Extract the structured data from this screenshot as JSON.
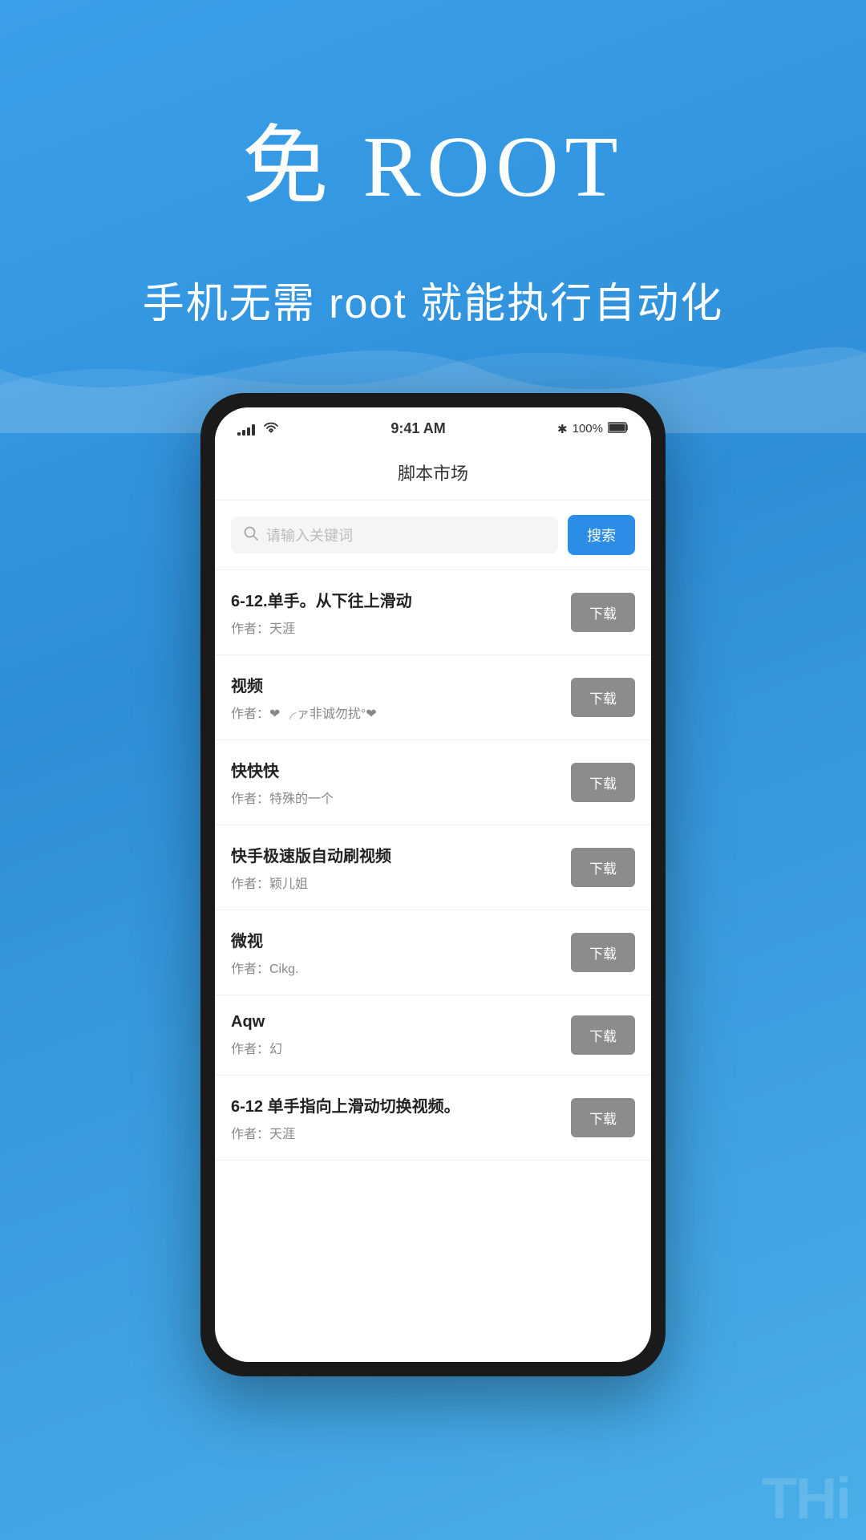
{
  "hero": {
    "title": "免 ROOT",
    "subtitle": "手机无需 root 就能执行自动化"
  },
  "phone": {
    "statusBar": {
      "time": "9:41 AM",
      "battery": "100%",
      "bluetooth": "✱"
    },
    "appTitle": "脚本市场",
    "search": {
      "placeholder": "请输入关键词",
      "buttonLabel": "搜索"
    },
    "scripts": [
      {
        "name": "6-12.单手。从下往上滑动",
        "author": "作者：天涯",
        "authorHasHeart": false,
        "downloadLabel": "下载"
      },
      {
        "name": "视频",
        "author": "作者：❤ ╭ァ非诚勿扰°❤",
        "authorHasHeart": true,
        "downloadLabel": "下载"
      },
      {
        "name": "快快快",
        "author": "作者：特殊的一个",
        "authorHasHeart": false,
        "downloadLabel": "下载"
      },
      {
        "name": "快手极速版自动刷视频",
        "author": "作者：颖儿姐",
        "authorHasHeart": false,
        "downloadLabel": "下载"
      },
      {
        "name": "微视",
        "author": "作者：Cikg.",
        "authorHasHeart": false,
        "downloadLabel": "下载"
      },
      {
        "name": "Aqw",
        "author": "作者：幻",
        "authorHasHeart": false,
        "downloadLabel": "下载"
      },
      {
        "name": "6-12  单手指向上滑动切换视频。",
        "author": "作者：天涯",
        "authorHasHeart": false,
        "downloadLabel": "下载"
      }
    ]
  },
  "bottomText": "THi",
  "colors": {
    "bgGradientStart": "#3a9fea",
    "bgGradientEnd": "#2e8fd8",
    "searchButton": "#2b8de6",
    "downloadButton": "#8c8c8c"
  }
}
